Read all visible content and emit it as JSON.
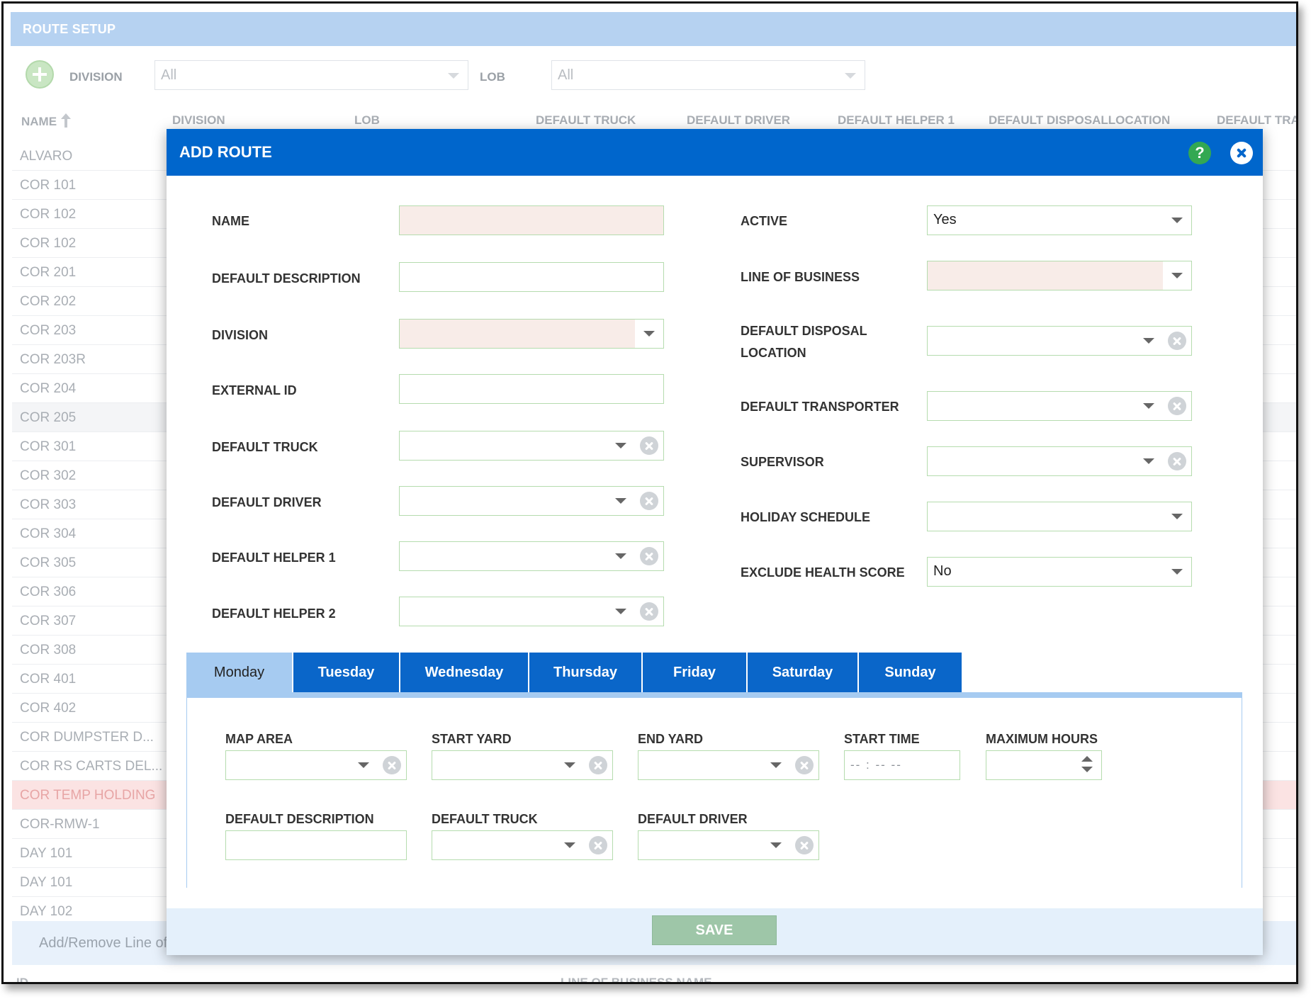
{
  "page": {
    "title": "ROUTE SETUP",
    "filters": {
      "division_label": "DIVISION",
      "division_value": "All",
      "lob_label": "LOB",
      "lob_value": "All"
    },
    "columns": [
      "NAME",
      "DIVISION",
      "LOB",
      "DEFAULT TRUCK",
      "DEFAULT DRIVER",
      "DEFAULT HELPER 1",
      "DEFAULT DISPOSALLOCATION",
      "DEFAULT TRA"
    ],
    "rows": [
      "ALVARO",
      "COR 101",
      "COR 102",
      "COR 102",
      "COR 201",
      "COR 202",
      "COR 203",
      "COR 203R",
      "COR 204",
      "COR 205",
      "COR 301",
      "COR 302",
      "COR 303",
      "COR 304",
      "COR 305",
      "COR 306",
      "COR 307",
      "COR 308",
      "COR 401",
      "COR 402",
      "COR DUMPSTER D...",
      "COR RS CARTS DEL...",
      "COR TEMP HOLDING",
      "COR-RMW-1",
      "DAY 101",
      "DAY 101",
      "DAY 102"
    ],
    "footer_text": "Add/Remove Line of",
    "bottom_columns": [
      "ID",
      "LINE OF BUSINESS NAME"
    ]
  },
  "modal": {
    "title": "ADD ROUTE",
    "help_glyph": "?",
    "left_fields": {
      "name": {
        "label": "NAME",
        "value": ""
      },
      "default_description": {
        "label": "DEFAULT DESCRIPTION",
        "value": ""
      },
      "division": {
        "label": "DIVISION",
        "value": ""
      },
      "external_id": {
        "label": "EXTERNAL ID",
        "value": ""
      },
      "default_truck": {
        "label": "DEFAULT TRUCK",
        "value": ""
      },
      "default_driver": {
        "label": "DEFAULT DRIVER",
        "value": ""
      },
      "default_helper_1": {
        "label": "DEFAULT HELPER 1",
        "value": ""
      },
      "default_helper_2": {
        "label": "DEFAULT HELPER 2",
        "value": ""
      }
    },
    "right_fields": {
      "active": {
        "label": "ACTIVE",
        "value": "Yes"
      },
      "line_of_business": {
        "label": "LINE OF BUSINESS",
        "value": ""
      },
      "default_disposal_location": {
        "label": "DEFAULT DISPOSAL LOCATION",
        "value": ""
      },
      "default_transporter": {
        "label": "DEFAULT TRANSPORTER",
        "value": ""
      },
      "supervisor": {
        "label": "SUPERVISOR",
        "value": ""
      },
      "holiday_schedule": {
        "label": "HOLIDAY SCHEDULE",
        "value": ""
      },
      "exclude_health_score": {
        "label": "EXCLUDE HEALTH SCORE",
        "value": "No"
      }
    },
    "tabs": [
      "Monday",
      "Tuesday",
      "Wednesday",
      "Thursday",
      "Friday",
      "Saturday",
      "Sunday"
    ],
    "active_tab": "Monday",
    "day_fields": {
      "map_area": "MAP AREA",
      "start_yard": "START YARD",
      "end_yard": "END YARD",
      "start_time": "START TIME",
      "start_time_placeholder": "-- : --   --",
      "maximum_hours": "MAXIMUM HOURS",
      "default_description": "DEFAULT DESCRIPTION",
      "default_truck": "DEFAULT TRUCK",
      "default_driver": "DEFAULT DRIVER"
    },
    "save_label": "SAVE"
  },
  "colors": {
    "header_blue": "#0066cc",
    "title_bar": "#b6d2f1",
    "field_border": "#b5dcae",
    "required_fill": "#f8ece8",
    "save_button": "#9ec6a8"
  },
  "icons": [
    "add-circle-icon",
    "sort-ascending-icon",
    "help-icon",
    "close-icon",
    "chevron-down-icon",
    "clear-icon",
    "spinner-icon"
  ]
}
